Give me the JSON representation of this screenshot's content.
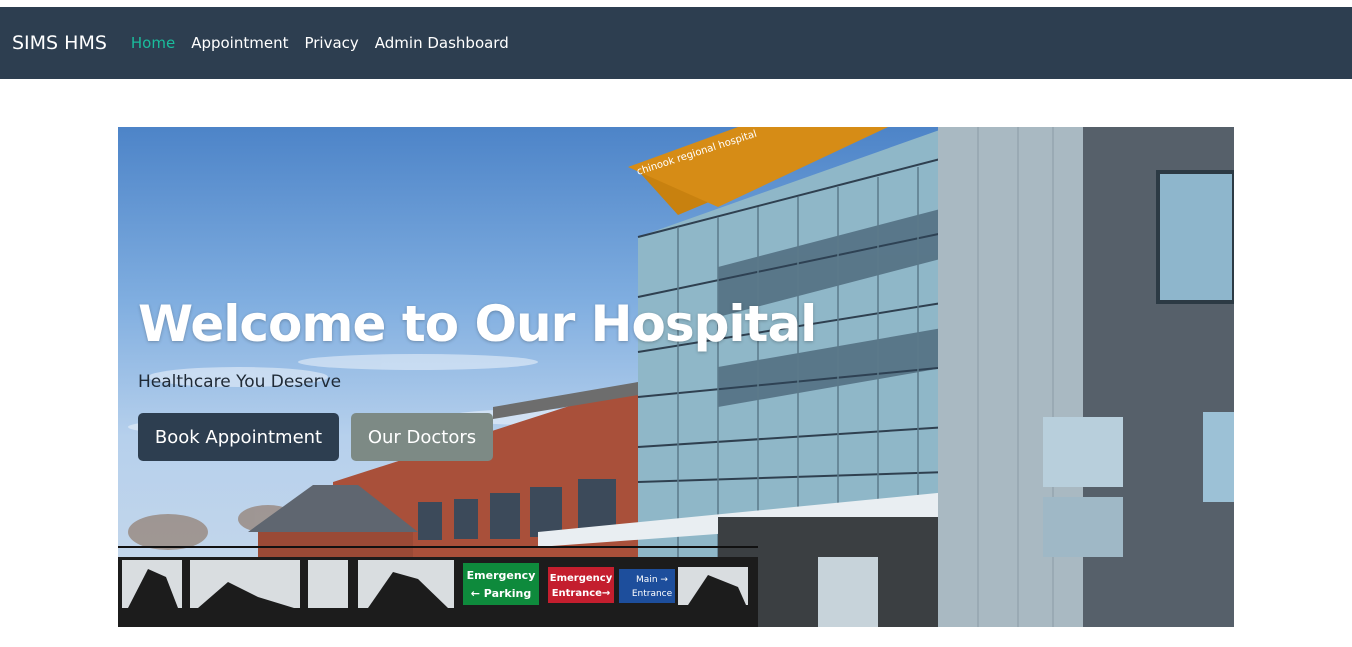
{
  "navbar": {
    "brand": "SIMS HMS",
    "links": [
      {
        "label": "Home",
        "active": true
      },
      {
        "label": "Appointment",
        "active": false
      },
      {
        "label": "Privacy",
        "active": false
      },
      {
        "label": "Admin Dashboard",
        "active": false
      }
    ]
  },
  "hero": {
    "title": "Welcome to Our Hospital",
    "subtitle": "Healthcare You Deserve",
    "buttons": {
      "primary": "Book Appointment",
      "secondary": "Our Doctors"
    },
    "image_signs": {
      "building_name": "chinook regional hospital",
      "sign_parking_1": "Emergency",
      "sign_parking_2": "← Parking",
      "sign_entrance_1": "Emergency",
      "sign_entrance_2": "Entrance→",
      "sign_main_1": "Main →",
      "sign_main_2": "Entrance"
    }
  },
  "colors": {
    "navbar_bg": "#2d3e50",
    "active_link": "#1abc9c",
    "primary_button": "#2d3e50",
    "secondary_button": "#7d8a85"
  }
}
